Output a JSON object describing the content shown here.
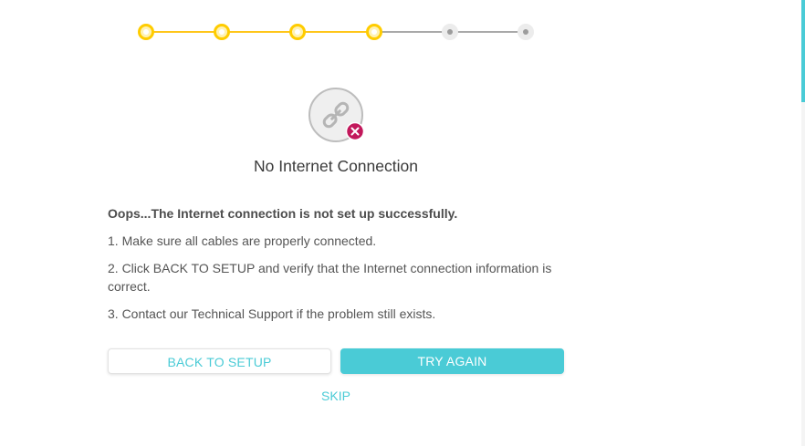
{
  "stepper": {
    "total_steps": 6,
    "completed_steps": 4
  },
  "status": {
    "icon": "broken-link-icon",
    "badge_icon": "close-icon",
    "title": "No Internet Connection"
  },
  "message": {
    "headline": "Oops...The Internet connection is not set up successfully.",
    "steps": [
      "1. Make sure all cables are properly connected.",
      "2. Click BACK TO SETUP and verify that the Internet connection information is correct.",
      "3. Contact our Technical Support if the problem still exists."
    ]
  },
  "actions": {
    "back_label": "BACK TO SETUP",
    "try_again_label": "TRY AGAIN",
    "skip_label": "SKIP"
  },
  "colors": {
    "accent": "#4acbd6",
    "step_done": "#ffcc00",
    "step_todo": "#a9a9a9",
    "error_badge": "#c2185b"
  }
}
